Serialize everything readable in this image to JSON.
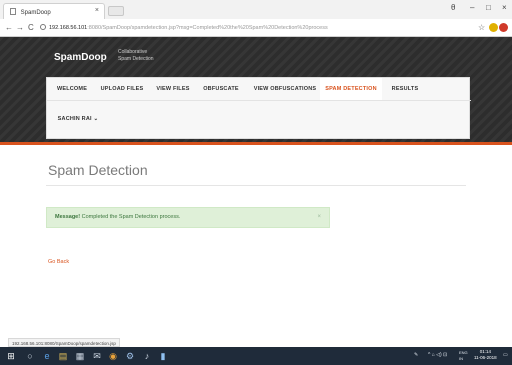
{
  "browser": {
    "tab_title": "SpamDoop",
    "tab_close": "×",
    "url_host": "192.168.56.101",
    "url_rest": ":8080/SpamDoop/spamdetection.jsp?msg=Completed%20the%20Spam%20Detection%20process",
    "nav": {
      "back": "←",
      "forward": "→",
      "reload": "C"
    },
    "window_controls": {
      "profile": "θ",
      "minimize": "–",
      "maximize": "□",
      "close": "×"
    },
    "star": "☆"
  },
  "site": {
    "brand": "SpamDoop",
    "tagline_line1": "Collaborative",
    "tagline_line2": "Spam Detection",
    "nav_row1": [
      "WELCOME",
      "UPLOAD FILES",
      "VIEW FILES",
      "OBFUSCATE",
      "VIEW OBFUSCATIONS",
      "SPAM DETECTION",
      "RESULTS"
    ],
    "user_menu": "SACHIN RAI",
    "active_nav": "SPAM DETECTION",
    "accent_color": "#d9531e"
  },
  "main": {
    "title": "Spam Detection",
    "alert_strong": "Message!",
    "alert_text": " Completed the Spam Detection process.",
    "alert_close": "×",
    "go_back": "Go Back"
  },
  "status_bar": {
    "url": "192.168.56.101:8080/SpamDoop/spamdetection.jsp"
  },
  "taskbar": {
    "tray_text": "^ 𝄐 ⊿ ENG",
    "lang": "ENG",
    "region": "IN",
    "time": "01:14",
    "date": "11-06-2018"
  }
}
